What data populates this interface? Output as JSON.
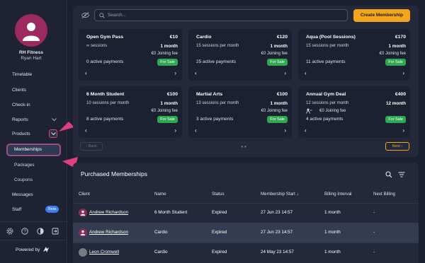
{
  "sidebar": {
    "org_name": "RH Fitness",
    "user_name": "Ryan Hart",
    "nav": {
      "timetable": "Timetable",
      "clients": "Clients",
      "checkin": "Check-in",
      "reports": "Reports",
      "products": "Products",
      "memberships": "Memberships",
      "packages": "Packages",
      "coupons": "Coupons",
      "messages": "Messages",
      "staff": "Staff",
      "beta": "Beta"
    },
    "powered_by": "Powered by"
  },
  "membership_panel": {
    "search_placeholder": "Search...",
    "create_button": "Create Membership",
    "cards": [
      {
        "title": "Open Gym Pass",
        "price": "€10",
        "sessions": "∞ sessions",
        "interval": "1 month",
        "fee": "€0 Joining fee",
        "payments": "0 active payments",
        "status": "For Sale"
      },
      {
        "title": "Cardio",
        "price": "€120",
        "sessions": "15 sessions per month",
        "interval": "1 month",
        "fee": "€0 Joining fee",
        "payments": "25 active payments",
        "status": "For Sale"
      },
      {
        "title": "Aqua (Pool Sessions)",
        "price": "€170",
        "sessions": "15 sessions per month",
        "interval": "1 month",
        "fee": "€0 Joining fee",
        "payments": "11 active payments",
        "status": "For Sale"
      },
      {
        "title": "6 Month Student",
        "price": "€100",
        "sessions": "10 sessions per month",
        "interval": "1 month",
        "fee": "€0 Joining fee",
        "payments": "8 active payments",
        "status": "For Sale"
      },
      {
        "title": "Martial Arts",
        "price": "€100",
        "sessions": "13 sessions per month",
        "interval": "1 month",
        "fee": "€0 Joining fee",
        "payments": "3 active payments",
        "status": "For Sale"
      },
      {
        "title": "Annual Gym Deal",
        "price": "€400",
        "sessions": "12 sessions per month",
        "interval": "12 month",
        "fee": "€0 Joining fee",
        "payments": "4 active payments",
        "status": "For Sale"
      }
    ],
    "back_label": "Back",
    "next_label": "Next"
  },
  "purchased": {
    "title": "Purchased Memberships",
    "columns": {
      "client": "Client",
      "name": "Name",
      "status": "Status",
      "start": "Membership Start",
      "interval": "Billing Interval",
      "next": "Next Billing"
    },
    "rows": [
      {
        "client": "Andrew Richardson",
        "name": "6 Month Student",
        "status": "Expired",
        "start": "27 Jun 23 14:57",
        "interval": "1 month",
        "next": "-"
      },
      {
        "client": "Andrew Richardson",
        "name": "Cardio",
        "status": "Expired",
        "start": "27 Jun 23 14:57",
        "interval": "1 month",
        "next": "-"
      },
      {
        "client": "Leon Cromwell",
        "name": "Cardio",
        "status": "Expired",
        "start": "24 May 23 14:57",
        "interval": "1 month",
        "next": "-"
      }
    ]
  },
  "colors": {
    "accent": "#f5a51a",
    "brand": "#9c2a5f",
    "sale": "#2fa84f",
    "highlight": "#e0407f"
  }
}
